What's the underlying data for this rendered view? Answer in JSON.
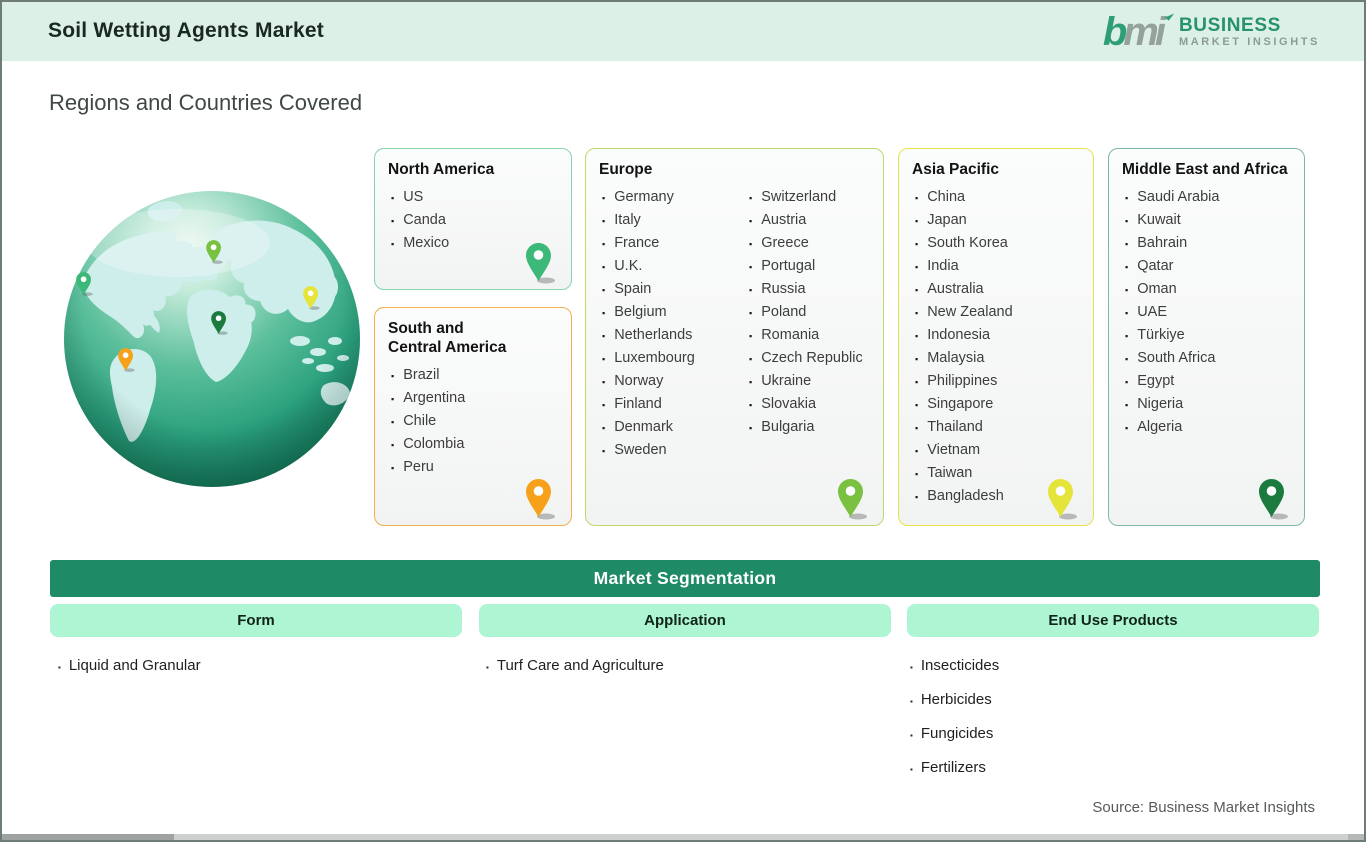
{
  "header": {
    "title": "Soil Wetting Agents Market",
    "logo_mark_green": "b",
    "logo_mark_gray": "mi",
    "logo_line1": "BUSINESS",
    "logo_line2": "MARKET INSIGHTS"
  },
  "section_title": "Regions and Countries Covered",
  "regions": {
    "north_america": {
      "title": "North America",
      "items": [
        "US",
        "Canda",
        "Mexico"
      ],
      "pin_color": "#3cb878",
      "border_color": "#87d5aa"
    },
    "south_central_america": {
      "title": "South and Central America",
      "items": [
        "Brazil",
        "Argentina",
        "Chile",
        "Colombia",
        "Peru"
      ],
      "pin_color": "#f7a11b",
      "border_color": "#f1b150"
    },
    "europe": {
      "title": "Europe",
      "items_col1": [
        "Germany",
        "Italy",
        "France",
        "U.K.",
        "Spain",
        "Belgium",
        "Netherlands",
        "Luxembourg",
        "Norway",
        "Finland",
        "Denmark",
        "Sweden"
      ],
      "items_col2": [
        "Switzerland",
        "Austria",
        "Greece",
        "Portugal",
        "Russia",
        "Poland",
        "Romania",
        "Czech Republic",
        "Ukraine",
        "Slovakia",
        "Bulgaria"
      ],
      "pin_color": "#7ac142",
      "border_color": "#bcd96d"
    },
    "asia_pacific": {
      "title": "Asia Pacific",
      "items": [
        "China",
        "Japan",
        "South Korea",
        "India",
        "Australia",
        "New Zealand",
        "Indonesia",
        "Malaysia",
        "Philippines",
        "Singapore",
        "Thailand",
        "Vietnam",
        "Taiwan",
        "Bangladesh"
      ],
      "pin_color": "#e5e43b",
      "border_color": "#e9e14b"
    },
    "middle_east_africa": {
      "title": "Middle East and Africa",
      "items": [
        "Saudi Arabia",
        "Kuwait",
        "Bahrain",
        "Qatar",
        "Oman",
        "UAE",
        "Türkiye",
        "South Africa",
        "Egypt",
        "Nigeria",
        "Algeria"
      ],
      "pin_color": "#1b7a3e",
      "border_color": "#7fb99d"
    }
  },
  "segmentation": {
    "title": "Market Segmentation",
    "columns": [
      {
        "label": "Form",
        "items": [
          "Liquid and Granular"
        ]
      },
      {
        "label": "Application",
        "items": [
          "Turf Care and Agriculture"
        ]
      },
      {
        "label": "End Use Products",
        "items": [
          "Insecticides",
          "Herbicides",
          "Fungicides",
          "Fertilizers"
        ]
      }
    ]
  },
  "source": "Source: Business Market Insights",
  "colors": {
    "header_bg": "#ddf0e7",
    "seg_bar_bg": "#1f8a66",
    "seg_col_bg": "#aef5d3",
    "brand_green": "#2f9e77",
    "brand_gray": "#8e9a94",
    "ocean_green": "#2aa07c",
    "land_mint": "#cdeeea"
  }
}
